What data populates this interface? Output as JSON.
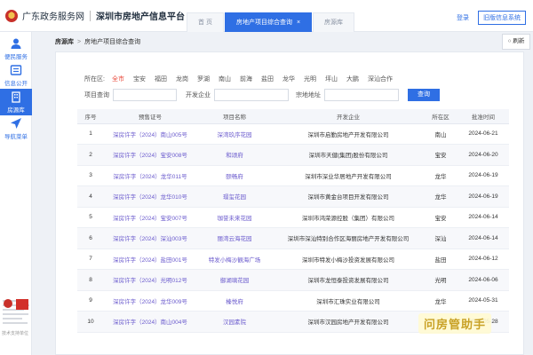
{
  "header": {
    "site_name": "广东政务服务网",
    "platform": "深圳市房地产信息平台",
    "tabs": [
      {
        "label": "首 页"
      },
      {
        "label": "房地产项目综合查询",
        "close": "×"
      },
      {
        "label": "房源库"
      }
    ],
    "login": "登录",
    "old_system": "旧版信息系统"
  },
  "sidebar": {
    "items": [
      {
        "label": "便民服务",
        "icon": "user-icon"
      },
      {
        "label": "信息公开",
        "icon": "info-icon"
      },
      {
        "label": "房源库",
        "icon": "building-icon"
      },
      {
        "label": "导航菜单",
        "icon": "navigation-icon"
      }
    ],
    "tech": "技术支持单位"
  },
  "breadcrumb": {
    "home": "房源库",
    "arrow": ">",
    "current": "房地产项目综合查询"
  },
  "refresh_label": "刷新",
  "filters": {
    "district_label": "所在区:",
    "districts": [
      "全市",
      "宝安",
      "福田",
      "龙岗",
      "罗湖",
      "南山",
      "前海",
      "盐田",
      "龙华",
      "光明",
      "坪山",
      "大鹏",
      "深汕合作"
    ],
    "active_district": "全市",
    "project_query_label": "项目查询",
    "developer_label": "开发企业",
    "parcel_label": "宗地地址",
    "search_label": "查询"
  },
  "table": {
    "headers": [
      "序号",
      "预售证号",
      "项目名称",
      "开发企业",
      "所在区",
      "批准时间"
    ],
    "rows": [
      [
        "1",
        "深房许字（2024）南山005号",
        "深湾玖序花园",
        "深圳市启勤房地产开发有限公司",
        "南山",
        "2024-06-21"
      ],
      [
        "2",
        "深房许字（2024）宝安008号",
        "和颂府",
        "深圳市天健(集团)股份有限公司",
        "宝安",
        "2024-06-20"
      ],
      [
        "3",
        "深房许字（2024）龙华011号",
        "颐畅府",
        "深圳市深业华居地产开发有限公司",
        "龙华",
        "2024-06-19"
      ],
      [
        "4",
        "深房许字（2024）龙华010号",
        "璟玺花园",
        "深圳市黄金台项目开发有限公司",
        "龙华",
        "2024-06-19"
      ],
      [
        "5",
        "深房许字（2024）宝安007号",
        "珈誉未来花园",
        "深圳市鸿荣源控股（集团）有限公司",
        "宝安",
        "2024-06-14"
      ],
      [
        "6",
        "深房许字（2024）深汕003号",
        "丽湾云海花园",
        "深圳市深汕特别合作区海丽房地产开发有限公司",
        "深汕",
        "2024-06-14"
      ],
      [
        "7",
        "深房许字（2024）盐田001号",
        "特发小梅沙観海广场",
        "深圳市特发小梅沙投资发展有限公司",
        "盐田",
        "2024-06-12"
      ],
      [
        "8",
        "深房许字（2024）光明012号",
        "御湖璃花园",
        "深圳市龙恒泰投资发展有限公司",
        "光明",
        "2024-06-06"
      ],
      [
        "9",
        "深房许字（2024）龙华009号",
        "榛悦府",
        "深圳市汇珠实业有限公司",
        "龙华",
        "2024-05-31"
      ],
      [
        "10",
        "深房许字（2024）南山004号",
        "汉园素院",
        "深圳市汉园房地产开发有限公司",
        "南山",
        "2024-05-28"
      ]
    ]
  },
  "watermark": "问房管助手"
}
